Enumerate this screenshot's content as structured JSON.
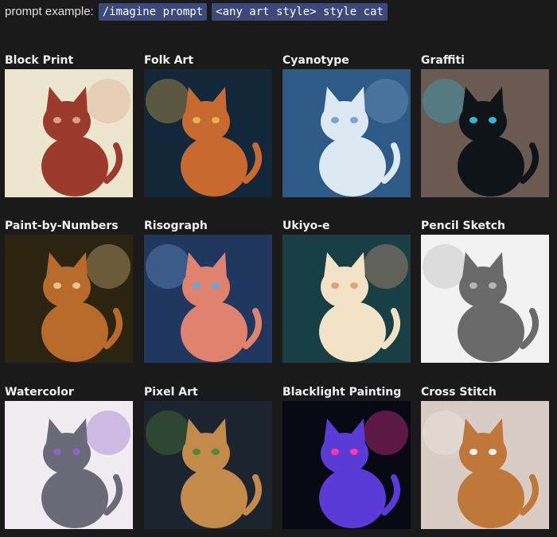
{
  "prompt": {
    "label": "prompt example:",
    "code1": "/imagine prompt",
    "code2": "<any art style> style cat"
  },
  "styles": [
    {
      "title": "Block Print",
      "icon": "block-print-cat-image",
      "bg": "#ede6cf",
      "fg": "#9a3b2c",
      "accent": "#d9a08a"
    },
    {
      "title": "Folk Art",
      "icon": "folk-art-cat-image",
      "bg": "#12283a",
      "fg": "#c8692f",
      "accent": "#e3b34c"
    },
    {
      "title": "Cyanotype",
      "icon": "cyanotype-cat-image",
      "bg": "#2d5a86",
      "fg": "#dce8f2",
      "accent": "#7fa5c8"
    },
    {
      "title": "Graffiti",
      "icon": "graffiti-cat-image",
      "bg": "#6a5a52",
      "fg": "#0f1418",
      "accent": "#2fb7d8"
    },
    {
      "title": "Paint-by-Numbers",
      "icon": "paint-by-numbers-cat-image",
      "bg": "#2a2410",
      "fg": "#b86a2a",
      "accent": "#e8c48a"
    },
    {
      "title": "Risograph",
      "icon": "risograph-cat-image",
      "bg": "#20375f",
      "fg": "#e0836e",
      "accent": "#6fa4d8"
    },
    {
      "title": "Ukiyo-e",
      "icon": "ukiyo-e-cat-image",
      "bg": "#173f45",
      "fg": "#f3e3c6",
      "accent": "#e7a07b"
    },
    {
      "title": "Pencil Sketch",
      "icon": "pencil-sketch-cat-image",
      "bg": "#f2f2f2",
      "fg": "#6a6a6a",
      "accent": "#b5b5b5"
    },
    {
      "title": "Watercolor",
      "icon": "watercolor-cat-image",
      "bg": "#f0ecf2",
      "fg": "#6a6a78",
      "accent": "#8a63c8"
    },
    {
      "title": "Pixel Art",
      "icon": "pixel-art-cat-image",
      "bg": "#1c2430",
      "fg": "#c48a4a",
      "accent": "#4e8a3a"
    },
    {
      "title": "Blacklight Painting",
      "icon": "blacklight-cat-image",
      "bg": "#070812",
      "fg": "#5a3bd8",
      "accent": "#ff3aa8"
    },
    {
      "title": "Cross Stitch",
      "icon": "cross-stitch-cat-image",
      "bg": "#d9ccc4",
      "fg": "#c0773a",
      "accent": "#f4efe8"
    }
  ]
}
